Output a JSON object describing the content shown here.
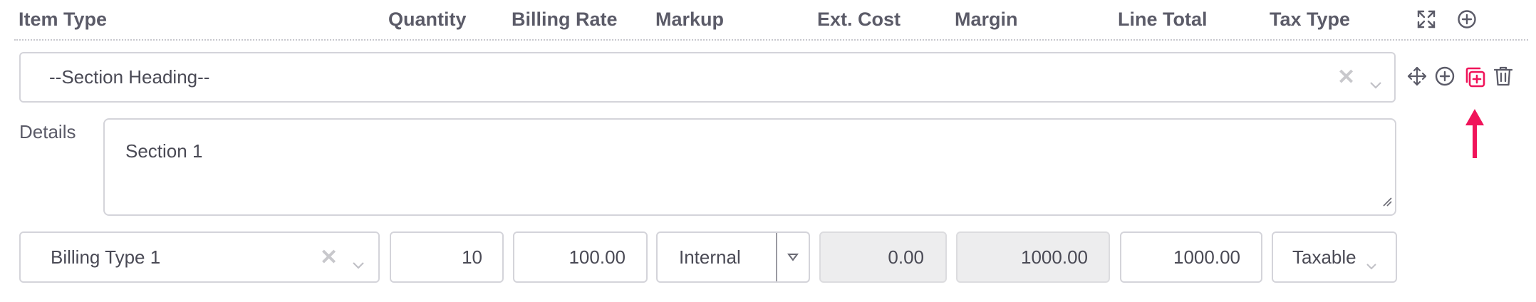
{
  "header": {
    "columns": [
      "Item Type",
      "Quantity",
      "Billing Rate",
      "Markup",
      "Ext. Cost",
      "Margin",
      "Line Total",
      "Tax Type"
    ],
    "icons": [
      "expand-icon",
      "add-circle-icon"
    ]
  },
  "section": {
    "heading_value": "--Section Heading--",
    "details_label": "Details",
    "details_value": "Section 1",
    "row_icons": [
      "move-icon",
      "add-circle-icon",
      "duplicate-icon",
      "trash-icon"
    ]
  },
  "line": {
    "billing_type": "Billing Type 1",
    "quantity": "10",
    "billing_rate": "100.00",
    "markup": "Internal",
    "ext_cost": "0.00",
    "margin": "1000.00",
    "line_total": "1000.00",
    "tax_type": "Taxable"
  },
  "colors": {
    "accent_highlight": "#f0145a",
    "text_header": "#5b5b68",
    "readonly_bg": "#ededee"
  }
}
